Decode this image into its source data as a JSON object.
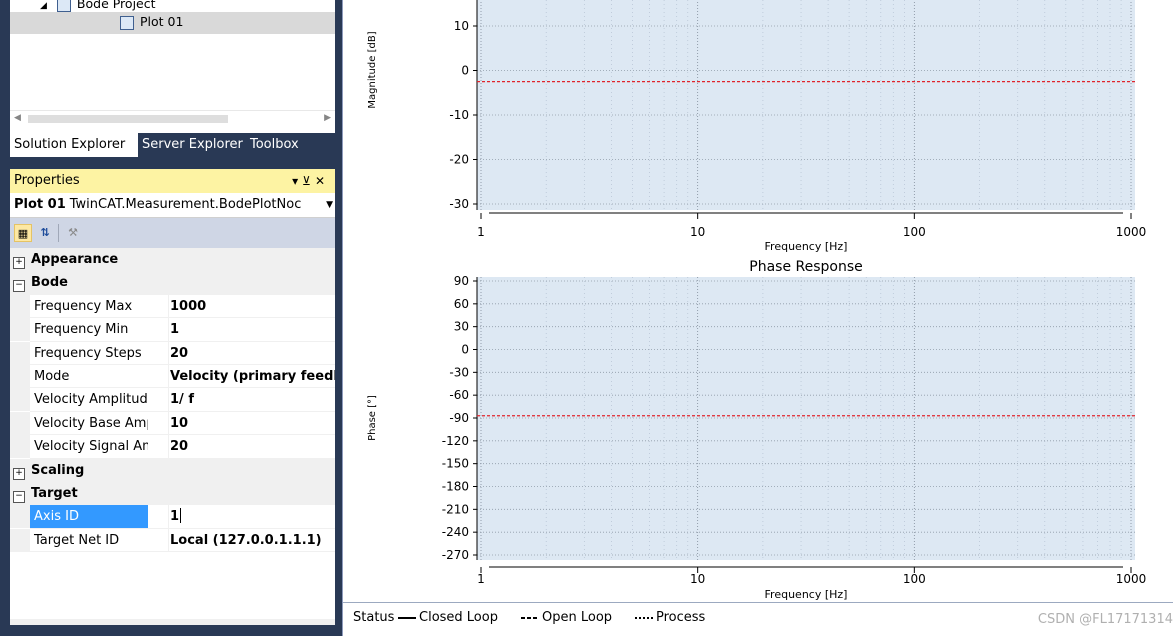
{
  "solution_explorer": {
    "project": "Bode Project",
    "plot": "Plot 01"
  },
  "tabs": [
    "Solution Explorer",
    "Server Explorer",
    "Toolbox"
  ],
  "properties": {
    "title": "Properties",
    "object_name": "Plot 01",
    "object_type": "TwinCAT.Measurement.BodePlotNoc",
    "categories": [
      {
        "name": "Appearance",
        "expanded": false,
        "items": []
      },
      {
        "name": "Bode",
        "expanded": true,
        "items": [
          {
            "name": "Frequency Max",
            "value": "1000"
          },
          {
            "name": "Frequency Min",
            "value": "1"
          },
          {
            "name": "Frequency Steps",
            "value": "20"
          },
          {
            "name": "Mode",
            "value": "Velocity (primary feedb"
          },
          {
            "name": "Velocity Amplitude S",
            "value": "1/ f"
          },
          {
            "name": "Velocity Base Amplit",
            "value": "10"
          },
          {
            "name": "Velocity Signal Amp",
            "value": "20"
          }
        ]
      },
      {
        "name": "Scaling",
        "expanded": false,
        "items": []
      },
      {
        "name": "Target",
        "expanded": true,
        "items": [
          {
            "name": "Axis ID",
            "value": "1",
            "selected": true
          },
          {
            "name": "Target Net ID",
            "value": "Local (127.0.0.1.1.1)"
          }
        ]
      }
    ]
  },
  "status_bar": {
    "status": "Status",
    "closed_loop": "Closed Loop",
    "open_loop": "Open Loop",
    "process": "Process"
  },
  "watermark": "CSDN @FL17171314",
  "colors": {
    "plot_bg": "#dde8f3",
    "trace": "#e0242b",
    "panel": "#293955",
    "properties_header": "#fdf3a3"
  },
  "chart_data": [
    {
      "type": "line",
      "title": "",
      "xlabel": "Frequency [Hz]",
      "ylabel": "Magnitude [dB]",
      "x_scale": "log",
      "xlim": [
        1,
        1000
      ],
      "x_ticks": [
        "1",
        "10",
        "100",
        "1000"
      ],
      "y_ticks": [
        10,
        0,
        -10,
        -20,
        -30
      ],
      "ylim": [
        -30,
        16
      ],
      "grid": true,
      "series": [
        {
          "x": [
            1,
            1000
          ],
          "y": [
            -2.5,
            -2.5
          ],
          "style": "dashed"
        }
      ]
    },
    {
      "type": "line",
      "title": "Phase Response",
      "xlabel": "Frequency [Hz]",
      "ylabel": "Phase [°]",
      "x_scale": "log",
      "xlim": [
        1,
        1000
      ],
      "x_ticks": [
        "1",
        "10",
        "100",
        "1000"
      ],
      "y_ticks": [
        90,
        60,
        30,
        0,
        -30,
        -60,
        -90,
        -120,
        -150,
        -180,
        -210,
        -240,
        -270
      ],
      "ylim": [
        -270,
        90
      ],
      "grid": true,
      "series": [
        {
          "x": [
            1,
            1000
          ],
          "y": [
            -87,
            -87
          ],
          "style": "dashed"
        }
      ]
    }
  ]
}
